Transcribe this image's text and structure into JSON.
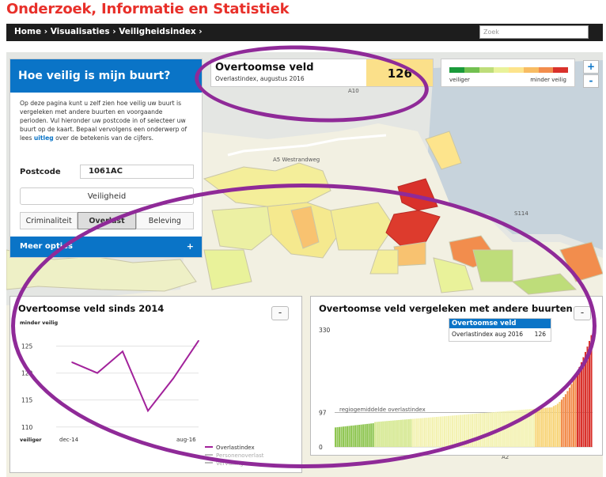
{
  "site_title": "Onderzoek, Informatie en Statistiek",
  "breadcrumb": "Home  ›  Visualisaties  ›  Veiligheidsindex  ›",
  "search": {
    "placeholder": "Zoek"
  },
  "panel": {
    "title": "Hoe veilig is mijn buurt?",
    "intro_1": "Op deze pagina kunt u zelf zien hoe veilig uw buurt is vergeleken met andere buurten en voorgaande perioden. Vul hieronder uw postcode in of selecteer uw buurt op de kaart. Bepaal vervolgens een onderwerp of lees ",
    "intro_link": "uitleg",
    "intro_2": " over de betekenis van de cijfers.",
    "postcode_label": "Postcode",
    "postcode_value": "1061AC",
    "veiligheid_button": "Veiligheid",
    "tabs": [
      "Criminaliteit",
      "Overlast",
      "Beleving"
    ],
    "meer_opties": "Meer opties",
    "meer_plus": "+"
  },
  "info": {
    "name": "Overtoomse veld",
    "subtitle": "Overlastindex, augustus 2016",
    "value": "126"
  },
  "legend": {
    "left": "veiliger",
    "right": "minder veilig",
    "colors": [
      "#1a9a3a",
      "#72c050",
      "#bedd7a",
      "#e9f29a",
      "#fde48c",
      "#f8bc63",
      "#f28d4d",
      "#d9312b"
    ]
  },
  "zoom": {
    "in": "+",
    "out": "-"
  },
  "map_labels": [
    "A10",
    "A5 Westrandweg",
    "S114",
    "A2"
  ],
  "chart_left": {
    "title": "Overtoomse veld sinds 2014",
    "minus": "-",
    "top_label": "minder veilig",
    "bottom_label": "veiliger",
    "legend_items": [
      "Overlastindex",
      "Personenoverlast",
      "Vervuiling"
    ]
  },
  "chart_right": {
    "title": "Overtoomse veld vergeleken met andere buurten",
    "minus": "-",
    "tooltip_title": "Overtoomse veld",
    "tooltip_label": "Overlastindex aug 2016",
    "tooltip_value": "126",
    "mean_label": "regiogemiddelde overlastindex"
  },
  "chart_data": [
    {
      "type": "line",
      "title": "Overtoomse veld sinds 2014",
      "x_tick_labels": [
        "dec-14",
        "aug-16"
      ],
      "y_ticks": [
        110,
        115,
        120,
        125
      ],
      "ylim": [
        108.5,
        128
      ],
      "series": [
        {
          "name": "Overlastindex",
          "color": "#a2229b",
          "values": [
            122,
            120,
            124,
            113,
            119,
            126
          ]
        }
      ]
    },
    {
      "type": "bar",
      "title": "Overtoomse veld vergeleken met andere buurten",
      "y_ticks": [
        0,
        97,
        330
      ],
      "ylim": [
        0,
        330
      ],
      "mean": 97,
      "highlight_value": 126,
      "n_bars": 130
    }
  ]
}
